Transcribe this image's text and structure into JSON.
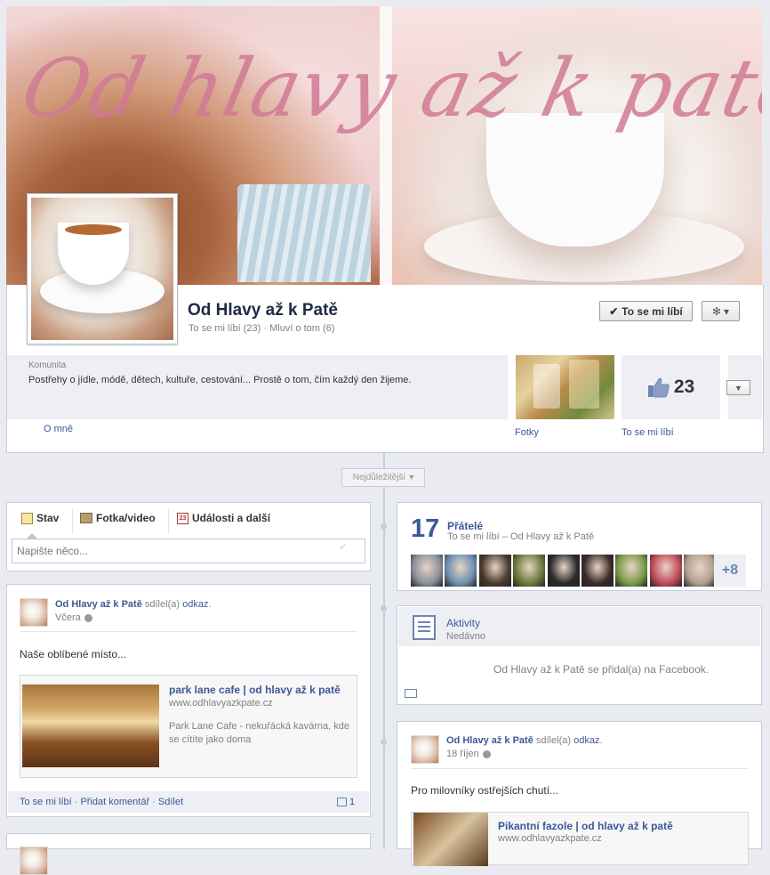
{
  "cover": {
    "title": "Od hlavy až k patě"
  },
  "page": {
    "name": "Od Hlavy až k Patě",
    "likes_text": "To se mi líbí (23)",
    "separator": " · ",
    "talking_text": "Mluví o tom (6)",
    "like_button": "To se mi líbí",
    "category": "Komunita",
    "description": "Postřehy o jídle, módě, dětech, kultuře, cestování... Prostě o tom, čím každý den žijeme.",
    "about_link": "O mně",
    "photos_label": "Fotky",
    "likes_count": "23",
    "likes_label": "To se mi líbí"
  },
  "timeline": {
    "sort_label": "Nejdůležitější"
  },
  "composer": {
    "tabs": [
      "Stav",
      "Fotka/video",
      "Události a další"
    ],
    "calendar_day": "23",
    "placeholder": "Napište něco..."
  },
  "post1": {
    "author": "Od Hlavy až k Patě",
    "action": " sdílel(a) ",
    "action_link": "odkaz",
    "action_end": ".",
    "time": "Včera",
    "text": "Naše oblíbené místo...",
    "link_title": "park lane cafe | od hlavy až k patě",
    "link_url": "www.odhlavyazkpate.cz",
    "link_desc": "Park Lane Cafe - nekuřácká kavárna, kde se cítíte jako doma",
    "actions": {
      "like": "To se mi líbí",
      "comment": "Přidat komentář",
      "share": "Sdílet",
      "sep": " · ",
      "comments_count": "1"
    }
  },
  "friends": {
    "count": "17",
    "title": "Přátelé",
    "subtitle": "To se mi líbí – Od Hlavy až k Patě",
    "more": "+8",
    "pic_colors": [
      "#8a8f99",
      "#6e8fb0",
      "#4a3a2e",
      "#6a7a3a",
      "#2a2a2a",
      "#3a2a2a",
      "#7a9a4a",
      "#c04a5a",
      "#b0a090"
    ]
  },
  "activity": {
    "title": "Aktivity",
    "subtitle": "Nedávno",
    "message": "Od Hlavy až k Patě se přidal(a) na Facebook."
  },
  "post2": {
    "author": "Od Hlavy až k Patě",
    "action": " sdílel(a) ",
    "action_link": "odkaz",
    "action_end": ".",
    "time": "18 říjen",
    "text": "Pro milovníky ostřejších chutí...",
    "link_title": "Pikantní fazole | od hlavy až k patě",
    "link_url": "www.odhlavyazkpate.cz"
  }
}
